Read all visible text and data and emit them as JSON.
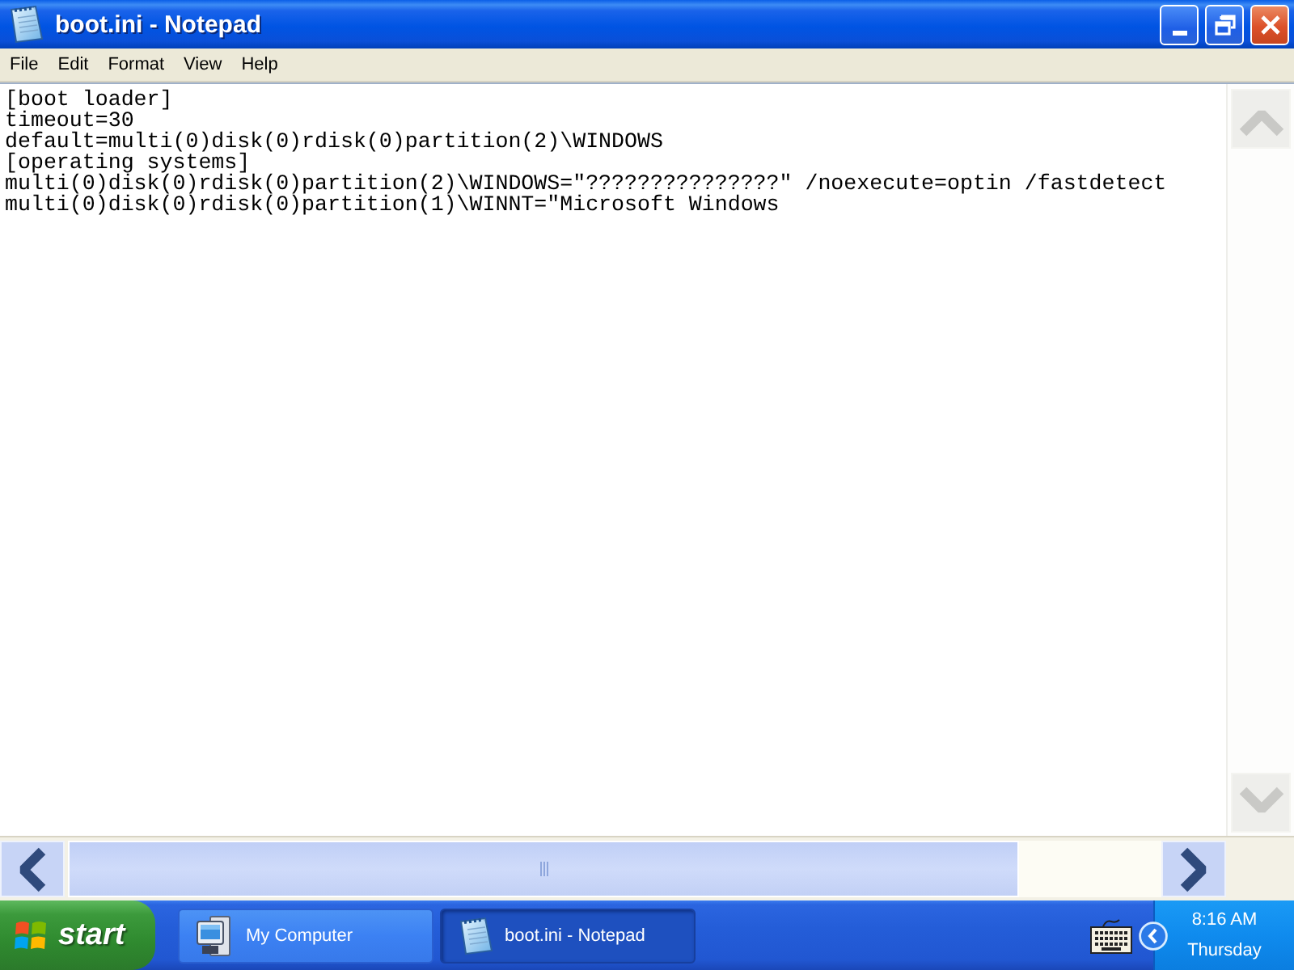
{
  "window": {
    "title": "boot.ini - Notepad"
  },
  "menu_bar": [
    "File",
    "Edit",
    "Format",
    "View",
    "Help"
  ],
  "document": {
    "lines": [
      "[boot loader]",
      "timeout=30",
      "default=multi(0)disk(0)rdisk(0)partition(2)\\WINDOWS",
      "[operating systems]",
      "multi(0)disk(0)rdisk(0)partition(2)\\WINDOWS=\"???????????????\" /noexecute=optin /fastdetect",
      "multi(0)disk(0)rdisk(0)partition(1)\\WINNT=\"Microsoft Windows"
    ]
  },
  "vertical_scrollbar": {
    "disabled": true
  },
  "horizontal_scrollbar": {
    "disabled": false
  },
  "taskbar": {
    "start": "start",
    "tasks": [
      {
        "label": "My Computer",
        "kind": "computer",
        "selected": false
      },
      {
        "label": "boot.ini - Notepad",
        "kind": "notepad",
        "selected": true
      }
    ],
    "clock": {
      "time": "8:16 AM",
      "day": "Thursday"
    }
  }
}
